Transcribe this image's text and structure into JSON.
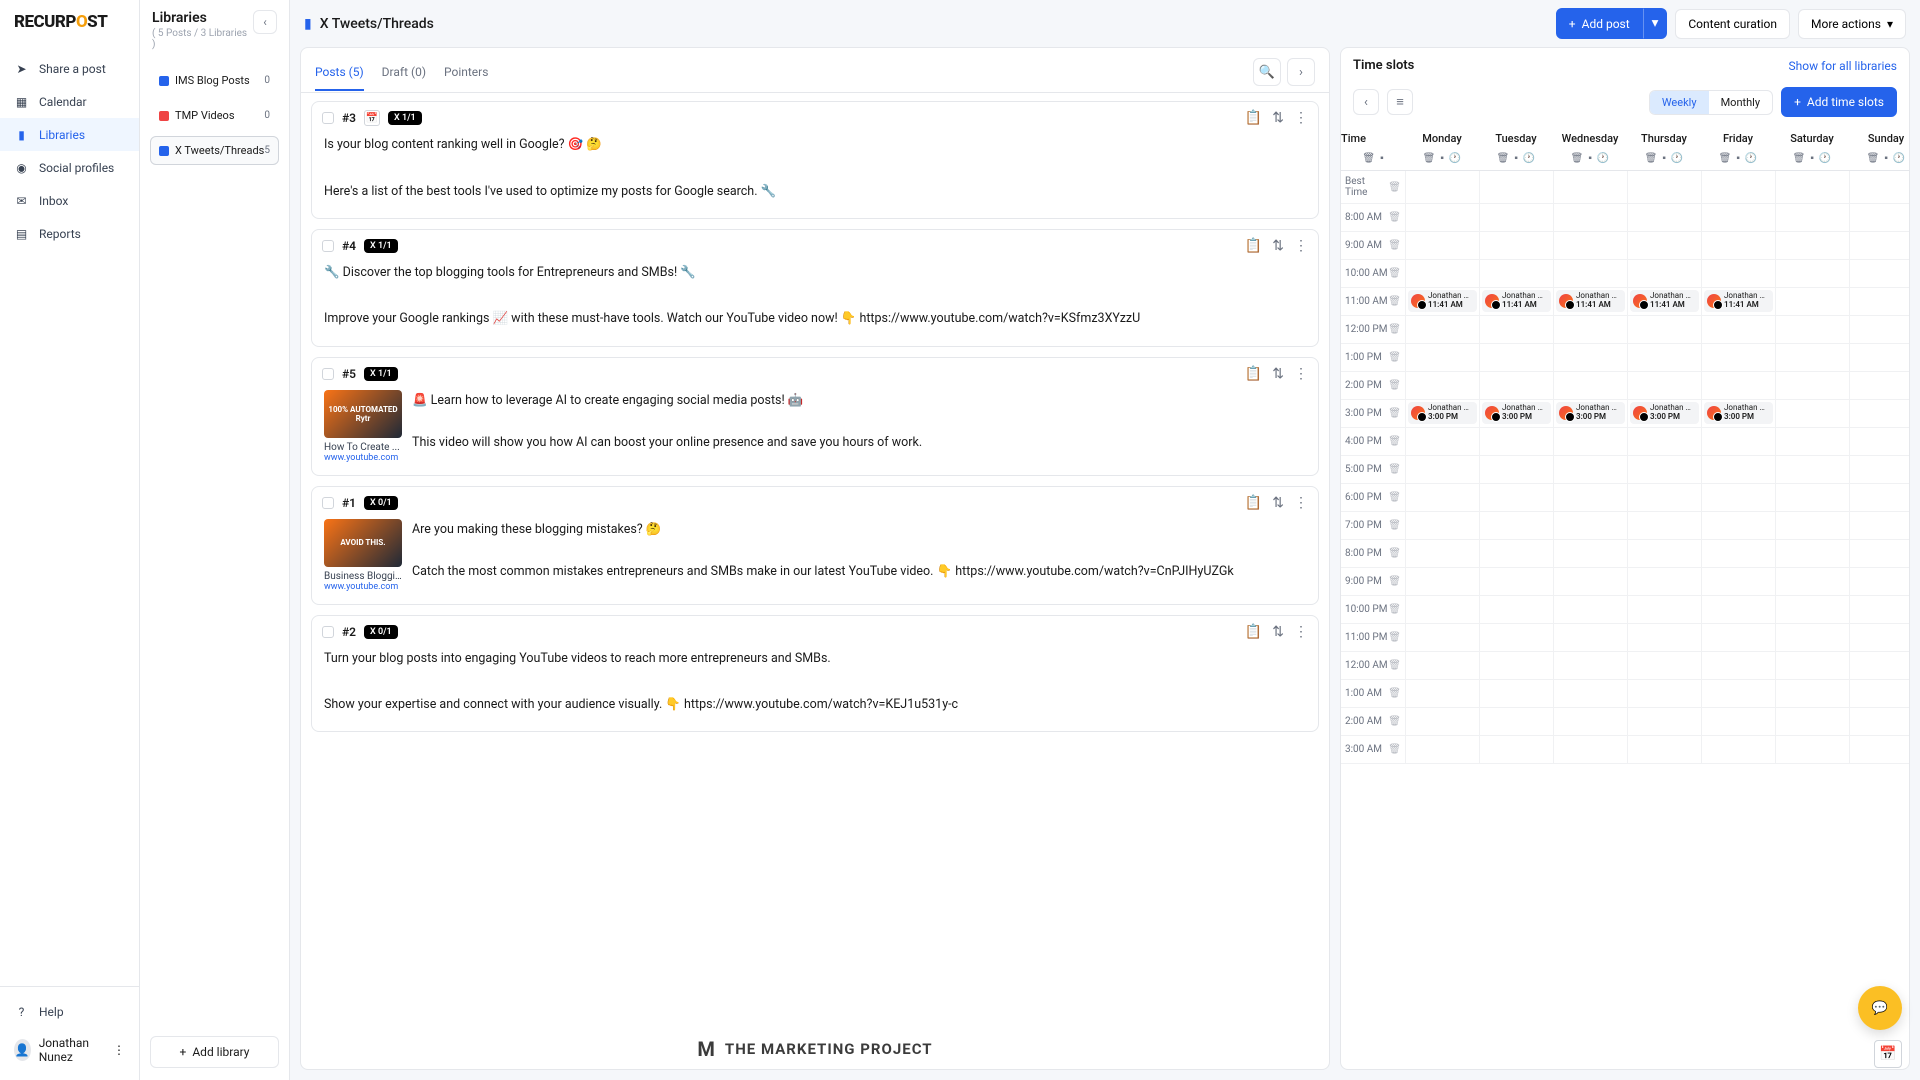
{
  "logo": {
    "pre": "RECURP",
    "accent": "O",
    "post": "ST"
  },
  "nav": [
    {
      "label": "Share a post",
      "icon": "➤"
    },
    {
      "label": "Calendar",
      "icon": "▦"
    },
    {
      "label": "Libraries",
      "icon": "▮",
      "active": true
    },
    {
      "label": "Social profiles",
      "icon": "◉"
    },
    {
      "label": "Inbox",
      "icon": "✉"
    },
    {
      "label": "Reports",
      "icon": "▤"
    }
  ],
  "help_label": "Help",
  "user": {
    "name": "Jonathan Nunez"
  },
  "libraries": {
    "title": "Libraries",
    "subtitle": "( 5 Posts / 3 Libraries )",
    "items": [
      {
        "name": "IMS Blog Posts",
        "count": "0",
        "color": "#2563eb"
      },
      {
        "name": "TMP Videos",
        "count": "0",
        "color": "#ef4444"
      },
      {
        "name": "X Tweets/Threads",
        "count": "5",
        "color": "#2563eb",
        "active": true
      }
    ],
    "add_label": "Add library"
  },
  "topbar": {
    "title": "X Tweets/Threads",
    "add_post": "Add post",
    "content_curation": "Content curation",
    "more_actions": "More actions"
  },
  "tabs": {
    "posts": "Posts (5)",
    "draft": "Draft (0)",
    "pointers": "Pointers"
  },
  "posts": [
    {
      "num": "#3",
      "badge": "X 1/1",
      "has_cal": true,
      "line1": "Is your blog content ranking well in Google? 🎯 🤔",
      "line2": "Here's a list of the best tools I've used to optimize my posts for Google search. 🔧"
    },
    {
      "num": "#4",
      "badge": "X 1/1",
      "line1": "🔧 Discover the top blogging tools for Entrepreneurs and SMBs! 🔧",
      "line2": "Improve your Google rankings 📈 with these must-have tools. Watch our YouTube video now! 👇 https://www.youtube.com/watch?v=KSfmz3XYzzU"
    },
    {
      "num": "#5",
      "badge": "X 1/1",
      "thumb_title": "How To Create ...",
      "thumb_url": "www.youtube.com",
      "thumb_text": "100% AUTOMATED Rytr",
      "line1": "🚨 Learn how to leverage AI to create engaging social media posts! 🤖",
      "line2": "This video will show you how AI can boost your online presence and save you hours of work."
    },
    {
      "num": "#1",
      "badge": "X 0/1",
      "thumb_title": "Business Bloggi...",
      "thumb_url": "www.youtube.com",
      "thumb_text": "AVOID THIS.",
      "line1": "Are you making these blogging mistakes? 🤔",
      "line2": "Catch the most common mistakes entrepreneurs and SMBs make in our latest YouTube video. 👇 https://www.youtube.com/watch?v=CnPJIHyUZGk"
    },
    {
      "num": "#2",
      "badge": "X 0/1",
      "line1": "Turn your blog posts into engaging YouTube videos to reach more entrepreneurs and SMBs.",
      "line2": "Show your expertise and connect with your audience visually. 👇 https://www.youtube.com/watch?v=KEJ1u531y-c"
    }
  ],
  "watermark": "THE MARKETING PROJECT",
  "timeslots": {
    "title": "Time slots",
    "show_all": "Show for all libraries",
    "weekly": "Weekly",
    "monthly": "Monthly",
    "add": "Add time slots",
    "day_header_time": "Time",
    "days": [
      "Monday",
      "Tuesday",
      "Wednesday",
      "Thursday",
      "Friday",
      "Saturday",
      "Sunday"
    ],
    "rows": [
      "Best Time",
      "8:00 AM",
      "9:00 AM",
      "10:00 AM",
      "11:00 AM",
      "12:00 PM",
      "1:00 PM",
      "2:00 PM",
      "3:00 PM",
      "4:00 PM",
      "5:00 PM",
      "6:00 PM",
      "7:00 PM",
      "8:00 PM",
      "9:00 PM",
      "10:00 PM",
      "11:00 PM",
      "12:00 AM",
      "1:00 AM",
      "2:00 AM",
      "3:00 AM"
    ],
    "event_name": "Jonathan Nuñ...",
    "event_11": "11:41 AM",
    "event_3": "3:00 PM"
  }
}
